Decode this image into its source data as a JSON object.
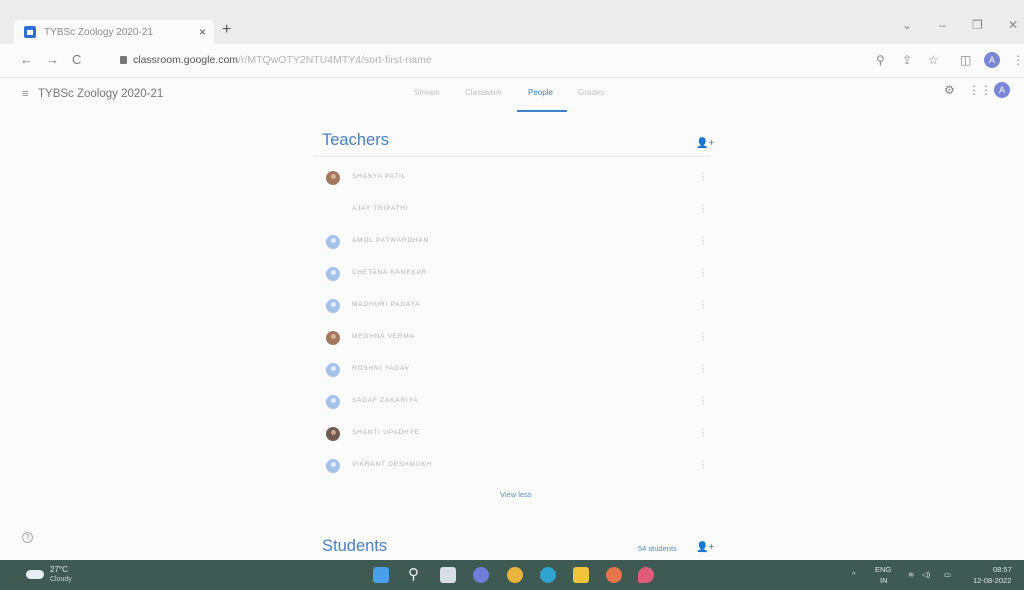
{
  "browser": {
    "tab_title": "TYBSc Zoology 2020-21",
    "tab_close": "×",
    "new_tab": "+",
    "url_host": "classroom.google.com",
    "url_path": "/r/MTQwOTY2NTU4MTY4/sort-first-name",
    "back": "←",
    "forward": "→",
    "reload": "C",
    "profile_initial": "A",
    "window_controls": {
      "chevron": "⌄",
      "minimize": "–",
      "restore": "❐",
      "close": "✕"
    }
  },
  "app": {
    "menu_icon": "≡",
    "class_title": "TYBSc Zoology 2020-21",
    "tabs": [
      {
        "label": "Stream"
      },
      {
        "label": "Classwork"
      },
      {
        "label": "People"
      },
      {
        "label": "Grades"
      }
    ],
    "active_tab": "People",
    "account_initial": "A"
  },
  "teachers": {
    "title": "Teachers",
    "list": [
      {
        "name": "SHASYA PATIL",
        "avatar": "photo"
      },
      {
        "name": "AJAY TRIPATHI",
        "avatar": "none"
      },
      {
        "name": "AMOL PATWARDHAN",
        "avatar": "default"
      },
      {
        "name": "CHETANA KANEKAR",
        "avatar": "default"
      },
      {
        "name": "MADHURI PADAYA",
        "avatar": "default"
      },
      {
        "name": "MEGHNA VERMA",
        "avatar": "photo"
      },
      {
        "name": "ROSHNI YADAV",
        "avatar": "default"
      },
      {
        "name": "SADAF ZAKARIYA",
        "avatar": "default"
      },
      {
        "name": "SHANTI UPADHYE",
        "avatar": "photo-alt"
      },
      {
        "name": "VIKRANT DESHMUKH",
        "avatar": "default"
      }
    ],
    "view_less": "View less"
  },
  "students": {
    "title": "Students",
    "count": "54 students"
  },
  "taskbar": {
    "temperature": "27°C",
    "weather": "Cloudy",
    "language": "ENG",
    "region": "IN",
    "time": "08:57",
    "date": "12-08-2022"
  },
  "colors": {
    "accent": "#4a7fc0",
    "taskbar": "#3f5a52"
  }
}
